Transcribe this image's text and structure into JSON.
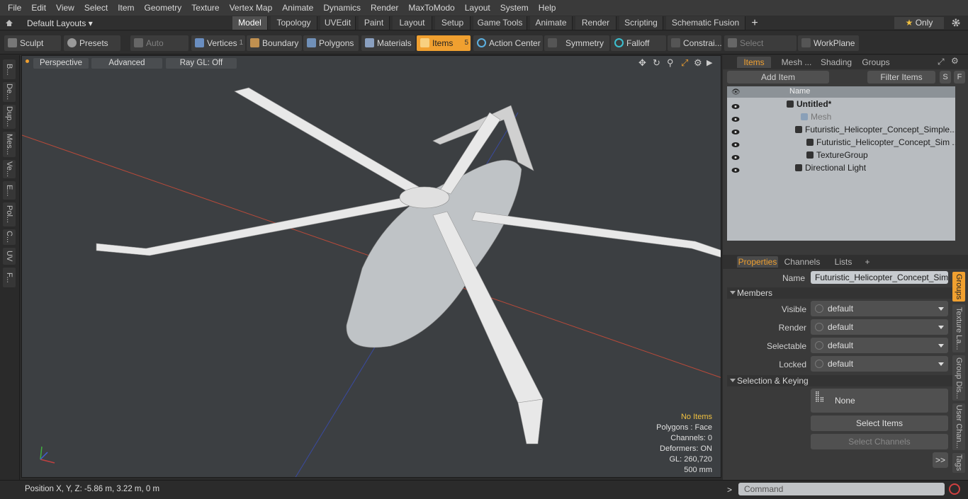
{
  "menu": [
    "File",
    "Edit",
    "View",
    "Select",
    "Item",
    "Geometry",
    "Texture",
    "Vertex Map",
    "Animate",
    "Dynamics",
    "Render",
    "MaxToModo",
    "Layout",
    "System",
    "Help"
  ],
  "layout_selector": "Default Layouts",
  "layout_tabs": [
    "Model",
    "Topology",
    "UVEdit",
    "Paint",
    "Layout",
    "Setup",
    "Game Tools",
    "Animate",
    "Render",
    "Scripting",
    "Schematic Fusion"
  ],
  "layout_plus": "+",
  "only_label": "Only",
  "toolbar": {
    "sculpt": "Sculpt",
    "presets": "Presets",
    "auto_select": "Auto Select",
    "vertices": "Vertices",
    "vertices_count": "1",
    "boundary": "Boundary",
    "polygons": "Polygons",
    "materials": "Materials",
    "items": "Items",
    "items_count": "5",
    "action_center": "Action Center",
    "symmetry": "Symmetry",
    "falloff": "Falloff",
    "constraints": "Constrai...",
    "select_through": "Select Through",
    "workplane": "WorkPlane"
  },
  "left_tabs": [
    "B...",
    "De...",
    "Dup...",
    "Mes...",
    "Ve...",
    "E...",
    "Pol...",
    "C...",
    "UV",
    "F..."
  ],
  "viewport": {
    "perspective": "Perspective",
    "advanced": "Advanced",
    "raygl": "Ray GL: Off",
    "hud": {
      "no_items": "No Items",
      "polygons": "Polygons : Face",
      "channels": "Channels: 0",
      "deformers": "Deformers: ON",
      "gl": "GL: 260,720",
      "scale": "500 mm"
    }
  },
  "items_panel": {
    "tabs": [
      "Items",
      "Mesh ...",
      "Shading",
      "Groups"
    ],
    "add_item": "Add Item",
    "filter": "Filter Items",
    "s": "S",
    "f": "F",
    "name_col": "Name",
    "tree": [
      "Untitled*",
      "Mesh",
      "Futuristic_Helicopter_Concept_Simple...",
      "Futuristic_Helicopter_Concept_Sim ...",
      "TextureGroup",
      "Directional Light"
    ]
  },
  "properties": {
    "tabs": [
      "Properties",
      "Channels",
      "Lists"
    ],
    "plus": "+",
    "name_label": "Name",
    "name_value": "Futuristic_Helicopter_Concept_Simple",
    "members": "Members",
    "visible": "Visible",
    "render": "Render",
    "selectable": "Selectable",
    "locked": "Locked",
    "default": "default",
    "selection_keying": "Selection & Keying",
    "none": "None",
    "select_items": "Select Items",
    "select_channels": "Select Channels",
    "more": ">>"
  },
  "right_vtabs": [
    "Groups",
    "Texture La...",
    "Group Dis...",
    "User Chan...",
    "Tags"
  ],
  "status": {
    "position": "Position X, Y, Z:  -5.86 m, 3.22 m, 0 m",
    "prompt": ">",
    "command": "Command"
  },
  "colors": {
    "accent": "#f0a030",
    "bg": "#2b2b2b",
    "viewport": "#3c3f42",
    "tree_bg": "#b8bcc0"
  }
}
